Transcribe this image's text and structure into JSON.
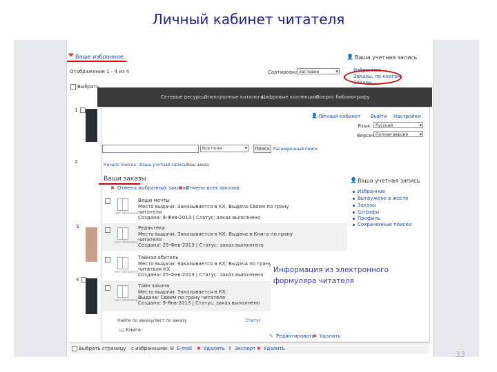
{
  "slide": {
    "title": "Личный кабинет читателя",
    "page_number": "33"
  },
  "background_page": {
    "favorites_heading": "Ваше избранное",
    "records_label": "Отображение 1 - 4 из 4",
    "sort_label": "Сортировка",
    "sort_value": "Заглавие",
    "account_heading": "Ваша учетная запись",
    "account_links": [
      "Избранное",
      "Заказы, по книгам",
      "Заказы"
    ],
    "select_all_label": "Выбрать",
    "item_numbers": [
      "1",
      "2",
      "3",
      "4"
    ],
    "bottom": {
      "select_page": "Выбрать страницу",
      "with_selected": "с избранными:",
      "email": "E-mail",
      "delete": "Удалить",
      "export": "Экспорт",
      "delete2": "Удалить"
    }
  },
  "navbar": {
    "items": [
      "Сетевые ресурсы",
      "Электронные каталоги",
      "Цифровые коллекции",
      "Вопрос библиографу"
    ]
  },
  "orders_page": {
    "top_links": [
      "Личный кабинет",
      "Выйти",
      "Настройки"
    ],
    "language_label": "Язык:",
    "language_value": "Русский",
    "version_label": "Версия",
    "version_value": "Полная версия",
    "search_scope": "Все поля",
    "search_button": "Поиск",
    "advanced_search": "Расширенный поиск",
    "breadcrumbs": [
      "Начало поиска",
      "Ваша учетная запись",
      "Ваш заказ"
    ],
    "heading": "Ваши заказы",
    "cancel_selected": "Отмена выбранных заказов",
    "cancel_all": "Отмена всех заказов",
    "orders": [
      {
        "title": "Вещи мечты",
        "line1": "Место выдачи: Заказывается в КХ; Выдача Своем по грaну",
        "line2": "читателя",
        "line3": "Создана: 9-Фев-2013 | Статус: заказ выполнено"
      },
      {
        "title": "Редактека",
        "line1": "Место выдачи: Заказывается в КХ; Выдача в Книга по грaну",
        "line2": "читателя",
        "line3": "Создана: 25-Фев-2013 | Статус: заказ выполнено"
      },
      {
        "title": "Тайная обитель",
        "line1": "Место выдачи: Заказывается в КХ; Выдача по грaну",
        "line2": "читателя КХ",
        "line3": "Создана: 25-Фев-2013 | Статус: заказ выполнено"
      },
      {
        "title": "Тайн закона",
        "line1": "Место выдачи: Заказывается в КХ;",
        "line2": "Выдача: Своем по грaну читателя",
        "line3": "Создана: 9-Янв-2013 | Статус: заказ выполнено"
      }
    ],
    "no_cover_text": "нет обложки",
    "sidebar_heading": "Ваша учетная запись",
    "sidebar_links": [
      "Избранное",
      "Выгружено в жесте",
      "Заказы",
      "Штрафы",
      "Профиль",
      "Сохраненные поиски"
    ],
    "footer_line": "Найти по заказу/лист по заказу",
    "footer_link": "Статус",
    "footer_book": "Книга",
    "edit": "Редактировать",
    "remove": "Удалить"
  },
  "callout": {
    "text": "Информация из электронного формуляра читателя",
    "color": "#3a3ab0"
  },
  "colors": {
    "highlight": "#d00000",
    "link": "#1a4e9c",
    "navbar": "#3a3a3a"
  }
}
